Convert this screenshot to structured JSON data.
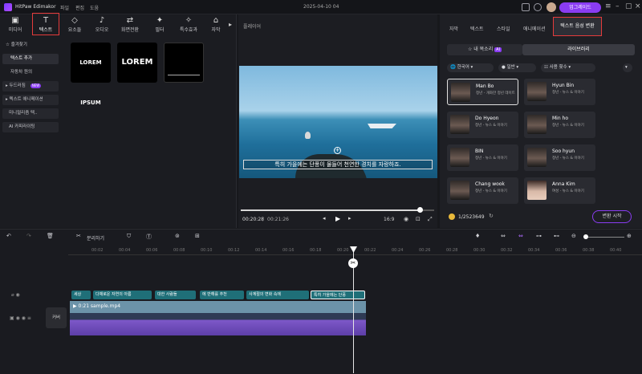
{
  "app": {
    "title": "HitPaw Edimakor",
    "menus": [
      "파일",
      "편집",
      "도움"
    ],
    "date": "2025-04-10 04",
    "upgrade_label": "업그레이드"
  },
  "tabs": [
    {
      "label": "미디어",
      "icon": "media-icon"
    },
    {
      "label": "텍스트",
      "icon": "text-icon"
    },
    {
      "label": "요소들",
      "icon": "elements-icon"
    },
    {
      "label": "오디오",
      "icon": "audio-icon"
    },
    {
      "label": "화면전환",
      "icon": "transition-icon"
    },
    {
      "label": "필터",
      "icon": "filter-icon"
    },
    {
      "label": "특수효과",
      "icon": "effects-icon"
    },
    {
      "label": "자막",
      "icon": "caption-icon"
    }
  ],
  "categories": [
    "즐겨찾기",
    "텍스트 추가",
    "자동차 원의",
    "두드러짐",
    "텍스트 애니메이션",
    "미니멀리즘 텍..",
    "AI 카피라이팅"
  ],
  "new_badge": "NEW",
  "thumbnails": [
    "LOREM IPSUM",
    "LOREM",
    ""
  ],
  "preview": {
    "title": "플레이어",
    "time_current": "00:20:28",
    "time_total": "00:21:26",
    "ratio": "16:9",
    "progress": 0.92,
    "subtitle": "특히 가을에는 단풍이 물들어 천연한 경치를 자랑하죠."
  },
  "right": {
    "tabs": [
      "자막",
      "텍스트",
      "스타일",
      "애니메이션",
      "텍스트 음성 변환"
    ],
    "seg_left": "내 목소리",
    "seg_left_badge": "AI",
    "seg_right": "라이브러리",
    "filters": [
      "한국어",
      "일반",
      "사용 횟수"
    ],
    "voices": [
      {
        "name": "Man Bo",
        "desc": "청년 - 개화한 청년 데이트"
      },
      {
        "name": "Hyun Bin",
        "desc": "청년 - 뉴스 & 이야기"
      },
      {
        "name": "Do Hyeon",
        "desc": "청년 - 뉴스 & 이야기"
      },
      {
        "name": "Min ho",
        "desc": "청년 - 뉴스 & 이야기"
      },
      {
        "name": "BIN",
        "desc": "청년 - 뉴스 & 이야기"
      },
      {
        "name": "Soo hyun",
        "desc": "청년 - 뉴스 & 이야기"
      },
      {
        "name": "Chang wook",
        "desc": "청년 - 뉴스 & 이야기"
      },
      {
        "name": "Anna Kim",
        "desc": "여성 - 뉴스 & 이야기"
      }
    ],
    "credits": "1/2523649",
    "create_label": "변환 시작"
  },
  "timeline": {
    "split_label": "분리하기",
    "ticks": [
      "00:02",
      "00:04",
      "00:06",
      "00:08",
      "00:10",
      "00:12",
      "00:14",
      "00:16",
      "00:18",
      "00:20",
      "00:22",
      "00:24",
      "00:26",
      "00:28",
      "00:30",
      "00:32",
      "00:34",
      "00:36",
      "00:38",
      "00:40"
    ],
    "subclips": [
      "세상",
      "다채로운 자연의 아름",
      "대한 사람들",
      "에 반해를 추천",
      "사계절의 변화 속에",
      "특히 가을에는 단풍"
    ],
    "video_label": "0:21 sample.mp4",
    "cover_label": "커버"
  }
}
